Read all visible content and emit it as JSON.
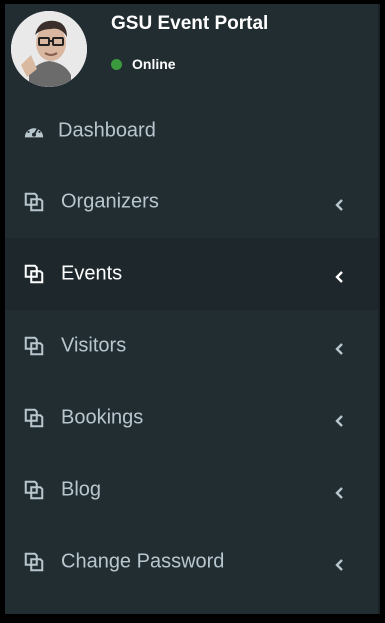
{
  "user": {
    "name": "GSU Event Portal",
    "status": "Online",
    "status_color": "#3c9a3e"
  },
  "menu": {
    "items": [
      {
        "label": "Dashboard",
        "icon": "dashboard-icon"
      },
      {
        "label": "Organizers",
        "icon": "copy-icon"
      },
      {
        "label": "Events",
        "icon": "copy-icon",
        "active": true
      },
      {
        "label": "Visitors",
        "icon": "copy-icon"
      },
      {
        "label": "Bookings",
        "icon": "copy-icon"
      },
      {
        "label": "Blog",
        "icon": "copy-icon"
      },
      {
        "label": "Change Password",
        "icon": "copy-icon"
      }
    ]
  },
  "colors": {
    "sidebar_bg": "#222d32",
    "active_bg": "#1e282c",
    "text": "#b8c7ce",
    "text_active": "#ffffff"
  }
}
